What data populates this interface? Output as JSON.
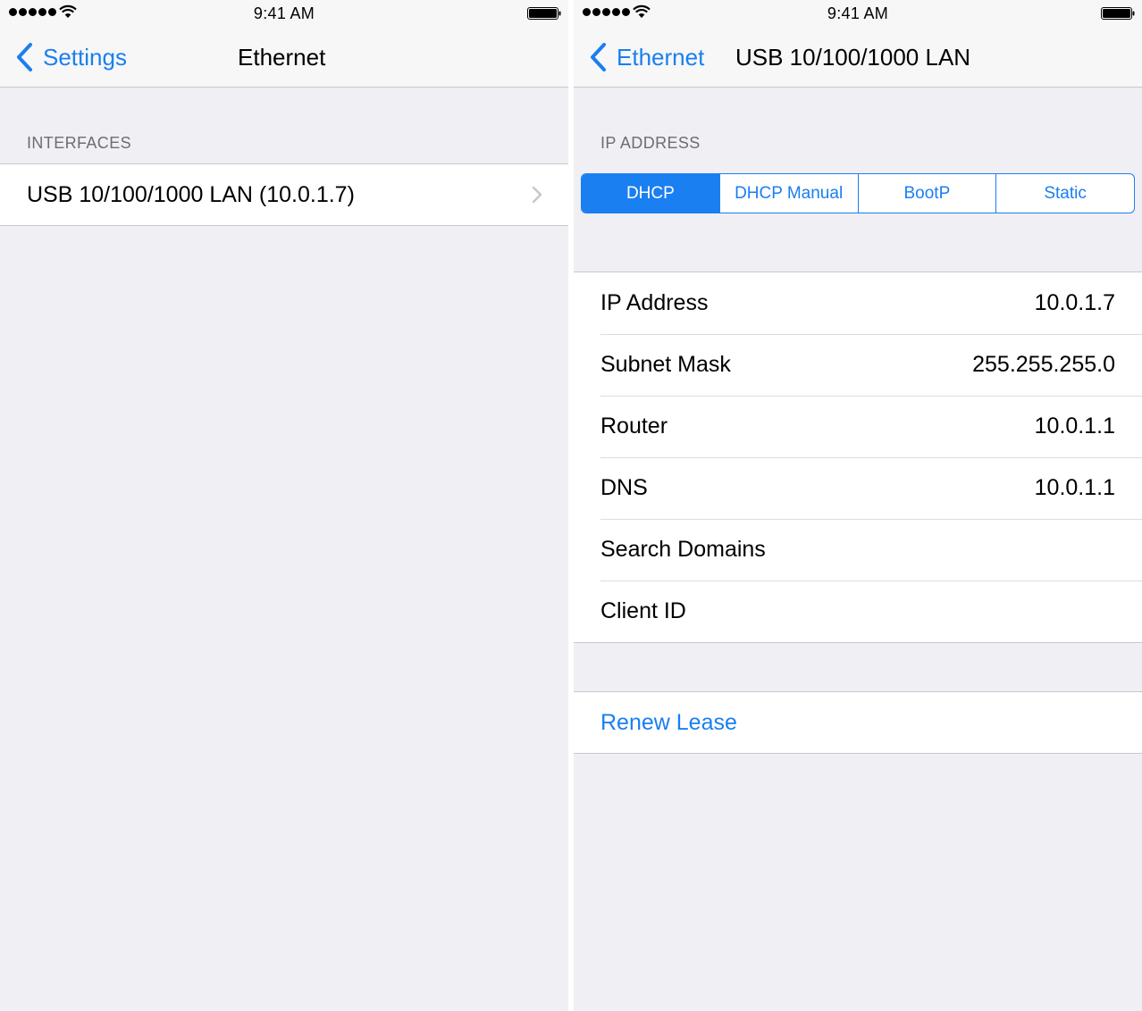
{
  "status_bar": {
    "time": "9:41 AM",
    "signal_icon": "signal-dots-icon",
    "wifi_icon": "wifi-icon",
    "battery_icon": "battery-icon"
  },
  "left_screen": {
    "back_label": "Settings",
    "title": "Ethernet",
    "section_header": "INTERFACES",
    "interfaces": [
      {
        "label": "USB 10/100/1000 LAN (10.0.1.7)"
      }
    ]
  },
  "right_screen": {
    "back_label": "Ethernet",
    "title": "USB 10/100/1000 LAN",
    "section_header": "IP ADDRESS",
    "segments": [
      "DHCP",
      "DHCP Manual",
      "BootP",
      "Static"
    ],
    "selected_segment": "DHCP",
    "rows": [
      {
        "label": "IP Address",
        "value": "10.0.1.7"
      },
      {
        "label": "Subnet Mask",
        "value": "255.255.255.0"
      },
      {
        "label": "Router",
        "value": "10.0.1.1"
      },
      {
        "label": "DNS",
        "value": "10.0.1.1"
      },
      {
        "label": "Search Domains",
        "value": ""
      },
      {
        "label": "Client ID",
        "value": ""
      }
    ],
    "renew_label": "Renew Lease"
  },
  "colors": {
    "accent": "#1a7ff0",
    "background": "#efeff4",
    "navbar": "#f7f7f7",
    "separator": "#c8c7cc",
    "section_text": "#6d6d72"
  }
}
